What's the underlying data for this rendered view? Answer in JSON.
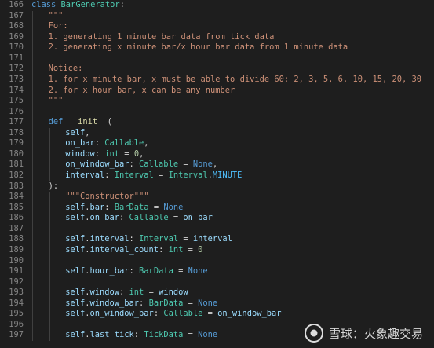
{
  "editor": {
    "theme_colors": {
      "background": "#1e1e1e",
      "line_number": "#858585",
      "keyword": "#569cd6",
      "class": "#4ec9b0",
      "string": "#ce9178",
      "function": "#dcdcaa",
      "number": "#b5cea8",
      "variable": "#9cdcfe",
      "constant": "#4fc1ff",
      "plain": "#d4d4d4"
    },
    "lines": [
      {
        "n": "166",
        "indent": 0,
        "tokens": [
          [
            "kw",
            "class "
          ],
          [
            "cls",
            "BarGenerator"
          ],
          [
            "plain",
            ":"
          ]
        ]
      },
      {
        "n": "167",
        "indent": 1,
        "tokens": [
          [
            "str",
            "\"\"\""
          ]
        ]
      },
      {
        "n": "168",
        "indent": 1,
        "tokens": [
          [
            "str",
            "For:"
          ]
        ]
      },
      {
        "n": "169",
        "indent": 1,
        "tokens": [
          [
            "str",
            "1. generating 1 minute bar data from tick data"
          ]
        ]
      },
      {
        "n": "170",
        "indent": 1,
        "tokens": [
          [
            "str",
            "2. generating x minute bar/x hour bar data from 1 minute data"
          ]
        ]
      },
      {
        "n": "171",
        "indent": 0,
        "tokens": []
      },
      {
        "n": "172",
        "indent": 1,
        "tokens": [
          [
            "str",
            "Notice:"
          ]
        ]
      },
      {
        "n": "173",
        "indent": 1,
        "tokens": [
          [
            "str",
            "1. for x minute bar, x must be able to divide 60: 2, 3, 5, 6, 10, 15, 20, 30"
          ]
        ]
      },
      {
        "n": "174",
        "indent": 1,
        "tokens": [
          [
            "str",
            "2. for x hour bar, x can be any number"
          ]
        ]
      },
      {
        "n": "175",
        "indent": 1,
        "tokens": [
          [
            "str",
            "\"\"\""
          ]
        ]
      },
      {
        "n": "176",
        "indent": 0,
        "tokens": []
      },
      {
        "n": "177",
        "indent": 1,
        "tokens": [
          [
            "kw",
            "def "
          ],
          [
            "fn",
            "__init__"
          ],
          [
            "plain",
            "("
          ]
        ]
      },
      {
        "n": "178",
        "indent": 2,
        "tokens": [
          [
            "var",
            "self"
          ],
          [
            "plain",
            ","
          ]
        ]
      },
      {
        "n": "179",
        "indent": 2,
        "tokens": [
          [
            "var",
            "on_bar"
          ],
          [
            "plain",
            ": "
          ],
          [
            "cls",
            "Callable"
          ],
          [
            "plain",
            ","
          ]
        ]
      },
      {
        "n": "180",
        "indent": 2,
        "tokens": [
          [
            "var",
            "window"
          ],
          [
            "plain",
            ": "
          ],
          [
            "cls",
            "int"
          ],
          [
            "plain",
            " = "
          ],
          [
            "num",
            "0"
          ],
          [
            "plain",
            ","
          ]
        ]
      },
      {
        "n": "181",
        "indent": 2,
        "tokens": [
          [
            "var",
            "on_window_bar"
          ],
          [
            "plain",
            ": "
          ],
          [
            "cls",
            "Callable"
          ],
          [
            "plain",
            " = "
          ],
          [
            "kw",
            "None"
          ],
          [
            "plain",
            ","
          ]
        ]
      },
      {
        "n": "182",
        "indent": 2,
        "tokens": [
          [
            "var",
            "interval"
          ],
          [
            "plain",
            ": "
          ],
          [
            "cls",
            "Interval"
          ],
          [
            "plain",
            " = "
          ],
          [
            "cls",
            "Interval"
          ],
          [
            "plain",
            "."
          ],
          [
            "const",
            "MINUTE"
          ]
        ]
      },
      {
        "n": "183",
        "indent": 1,
        "tokens": [
          [
            "plain",
            "):"
          ]
        ]
      },
      {
        "n": "184",
        "indent": 2,
        "tokens": [
          [
            "str",
            "\"\"\"Constructor\"\"\""
          ]
        ]
      },
      {
        "n": "185",
        "indent": 2,
        "tokens": [
          [
            "var",
            "self"
          ],
          [
            "plain",
            "."
          ],
          [
            "var",
            "bar"
          ],
          [
            "plain",
            ": "
          ],
          [
            "cls",
            "BarData"
          ],
          [
            "plain",
            " = "
          ],
          [
            "kw",
            "None"
          ]
        ]
      },
      {
        "n": "186",
        "indent": 2,
        "tokens": [
          [
            "var",
            "self"
          ],
          [
            "plain",
            "."
          ],
          [
            "var",
            "on_bar"
          ],
          [
            "plain",
            ": "
          ],
          [
            "cls",
            "Callable"
          ],
          [
            "plain",
            " = "
          ],
          [
            "var",
            "on_bar"
          ]
        ]
      },
      {
        "n": "187",
        "indent": 0,
        "tokens": []
      },
      {
        "n": "188",
        "indent": 2,
        "tokens": [
          [
            "var",
            "self"
          ],
          [
            "plain",
            "."
          ],
          [
            "var",
            "interval"
          ],
          [
            "plain",
            ": "
          ],
          [
            "cls",
            "Interval"
          ],
          [
            "plain",
            " = "
          ],
          [
            "var",
            "interval"
          ]
        ]
      },
      {
        "n": "189",
        "indent": 2,
        "tokens": [
          [
            "var",
            "self"
          ],
          [
            "plain",
            "."
          ],
          [
            "var",
            "interval_count"
          ],
          [
            "plain",
            ": "
          ],
          [
            "cls",
            "int"
          ],
          [
            "plain",
            " = "
          ],
          [
            "num",
            "0"
          ]
        ]
      },
      {
        "n": "190",
        "indent": 0,
        "tokens": []
      },
      {
        "n": "191",
        "indent": 2,
        "tokens": [
          [
            "var",
            "self"
          ],
          [
            "plain",
            "."
          ],
          [
            "var",
            "hour_bar"
          ],
          [
            "plain",
            ": "
          ],
          [
            "cls",
            "BarData"
          ],
          [
            "plain",
            " = "
          ],
          [
            "kw",
            "None"
          ]
        ]
      },
      {
        "n": "192",
        "indent": 0,
        "tokens": []
      },
      {
        "n": "193",
        "indent": 2,
        "tokens": [
          [
            "var",
            "self"
          ],
          [
            "plain",
            "."
          ],
          [
            "var",
            "window"
          ],
          [
            "plain",
            ": "
          ],
          [
            "cls",
            "int"
          ],
          [
            "plain",
            " = "
          ],
          [
            "var",
            "window"
          ]
        ]
      },
      {
        "n": "194",
        "indent": 2,
        "tokens": [
          [
            "var",
            "self"
          ],
          [
            "plain",
            "."
          ],
          [
            "var",
            "window_bar"
          ],
          [
            "plain",
            ": "
          ],
          [
            "cls",
            "BarData"
          ],
          [
            "plain",
            " = "
          ],
          [
            "kw",
            "None"
          ]
        ]
      },
      {
        "n": "195",
        "indent": 2,
        "tokens": [
          [
            "var",
            "self"
          ],
          [
            "plain",
            "."
          ],
          [
            "var",
            "on_window_bar"
          ],
          [
            "plain",
            ": "
          ],
          [
            "cls",
            "Callable"
          ],
          [
            "plain",
            " = "
          ],
          [
            "var",
            "on_window_bar"
          ]
        ]
      },
      {
        "n": "196",
        "indent": 0,
        "tokens": []
      },
      {
        "n": "197",
        "indent": 2,
        "tokens": [
          [
            "var",
            "self"
          ],
          [
            "plain",
            "."
          ],
          [
            "var",
            "last_tick"
          ],
          [
            "plain",
            ": "
          ],
          [
            "cls",
            "TickData"
          ],
          [
            "plain",
            " = "
          ],
          [
            "kw",
            "None"
          ]
        ]
      }
    ]
  },
  "watermark": {
    "text": "雪球：火象趣交易",
    "icon": "snowball-logo-icon"
  }
}
